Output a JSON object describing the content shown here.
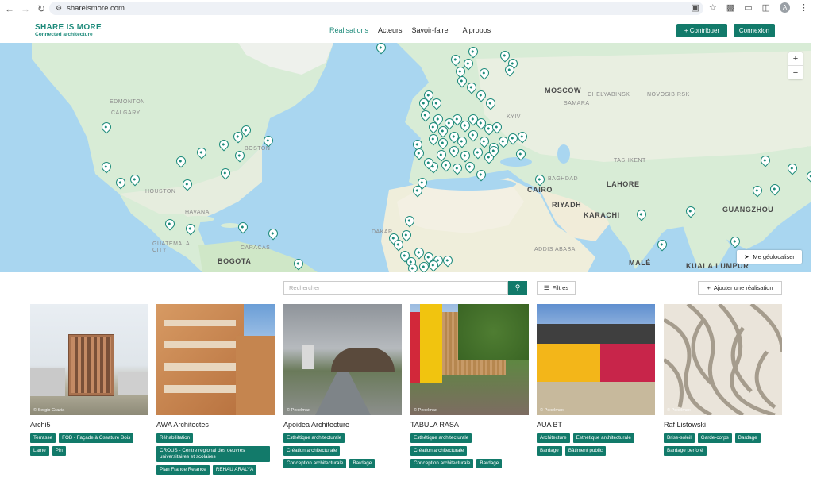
{
  "browser": {
    "url": "shareismore.com",
    "back_icon": "arrow-left-icon",
    "forward_icon": "arrow-right-icon",
    "reload_icon": "reload-icon",
    "profile_initial": "A"
  },
  "header": {
    "logo_line1": "SHARE IS MORE",
    "logo_line2": "Connected architecture",
    "nav": [
      {
        "label": "Réalisations",
        "active": true
      },
      {
        "label": "Acteurs",
        "active": false
      },
      {
        "label": "Savoir-faire",
        "active": false
      },
      {
        "label": "A propos",
        "active": false
      }
    ],
    "contribute_label": "+ Contribuer",
    "login_label": "Connexion",
    "accent_color": "#127a6a"
  },
  "map": {
    "labels_big": [
      "MOSCOW",
      "CAIRO",
      "RIYADH",
      "KARACHI",
      "LAHORE",
      "GUANGZHOU",
      "BOGOTA",
      "KUALA LUMPUR",
      "MALÉ"
    ],
    "labels_small": [
      "EDMONTON",
      "CALGARY",
      "BOSTON",
      "HOUSTON",
      "HAVANA",
      "GUATEMALA CITY",
      "CARACAS",
      "KYIV",
      "SAMARA",
      "CHELYABINSK",
      "NOVOSIBIRSK",
      "BAGHDAD",
      "TASHKENT",
      "ADDIS ABABA",
      "DAKAR"
    ],
    "zoom_in": "+",
    "zoom_out": "−",
    "geolocate_label": "Me géolocaliser"
  },
  "toolbar": {
    "search_placeholder": "Rechercher",
    "filters_label": "Filtres",
    "add_label": "Ajouter une réalisation"
  },
  "cards": [
    {
      "title": "Archi5",
      "credit": "© Sergio Grazia",
      "tags": [
        "Terrasse",
        "FOB - Façade à Ossature Bois",
        "Lame",
        "Pin"
      ]
    },
    {
      "title": "AWA Architectes",
      "credit": "",
      "tags": [
        "Réhabilitation",
        "CROUS - Centre régional des oeuvres universitaires et scolaires",
        "Plan France Relance",
        "REHAU ARALYA"
      ]
    },
    {
      "title": "Apoidea Architecture",
      "credit": "© Pexelmax",
      "tags": [
        "Esthétique architecturale",
        "Création architecturale",
        "Conception architecturale",
        "Bardage"
      ]
    },
    {
      "title": "TABULA RASA",
      "credit": "© Pexelmax",
      "tags": [
        "Esthétique architecturale",
        "Création architecturale",
        "Conception architecturale",
        "Bardage"
      ]
    },
    {
      "title": "AUA BT",
      "credit": "© Pexelmax",
      "tags": [
        "Architecture",
        "Esthétique architecturale",
        "Bardage",
        "Bâtiment public"
      ]
    },
    {
      "title": "Raf Listowski",
      "credit": "© Pexelmax",
      "tags": [
        "Brise-soleil",
        "Garde-corps",
        "Bardage",
        "Bardage perforé"
      ]
    }
  ]
}
